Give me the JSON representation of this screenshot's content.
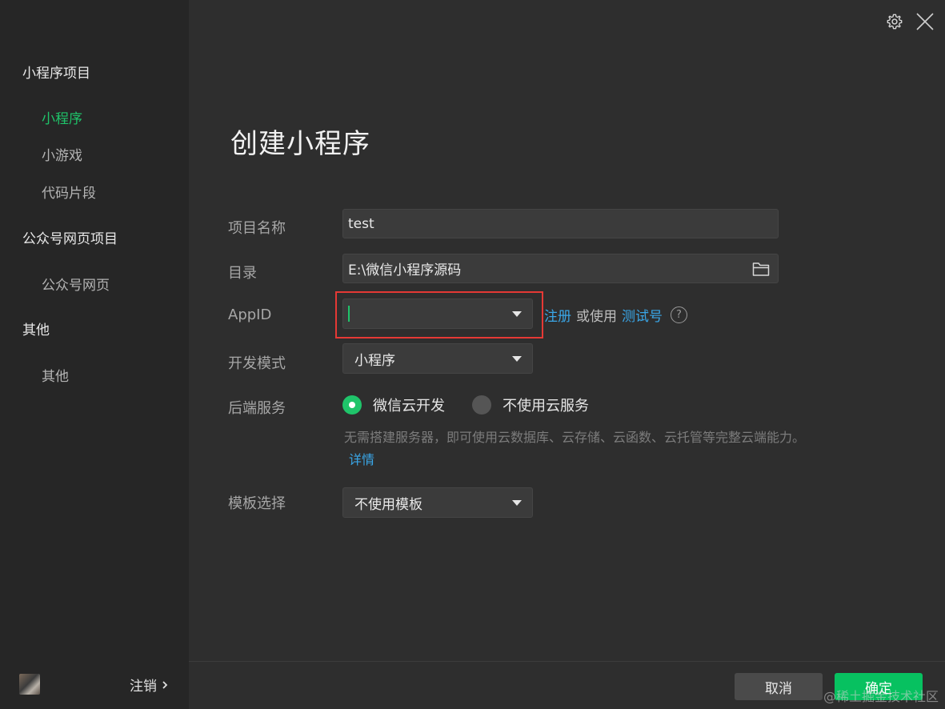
{
  "sidebar": {
    "groups": [
      {
        "title": "小程序项目",
        "items": [
          "小程序",
          "小游戏",
          "代码片段"
        ]
      },
      {
        "title": "公众号网页项目",
        "items": [
          "公众号网页"
        ]
      },
      {
        "title": "其他",
        "items": [
          "其他"
        ]
      }
    ],
    "active_item": "小程序",
    "logout_label": "注销"
  },
  "header": {
    "icons": [
      "gear-icon",
      "close-icon"
    ]
  },
  "form": {
    "title": "创建小程序",
    "project_name": {
      "label": "项目名称",
      "value": "test"
    },
    "directory": {
      "label": "目录",
      "value": "E:\\微信小程序源码"
    },
    "appid": {
      "label": "AppID",
      "value": "",
      "register_link": "注册",
      "or_use": "或使用",
      "test_link": "测试号",
      "help": "?"
    },
    "dev_mode": {
      "label": "开发模式",
      "value": "小程序"
    },
    "backend": {
      "label": "后端服务",
      "options": [
        "微信云开发",
        "不使用云服务"
      ],
      "selected": "微信云开发",
      "desc": "无需搭建服务器，即可使用云数据库、云存储、云函数、云托管等完整云端能力。",
      "details_link": "详情"
    },
    "template": {
      "label": "模板选择",
      "value": "不使用模板"
    }
  },
  "footer": {
    "cancel_label": "取消",
    "confirm_label": "确定",
    "watermark": "@稀土掘金技术社区"
  },
  "colors": {
    "accent_green": "#07c160",
    "link_blue": "#3aa7e8",
    "highlight_red": "#e53935"
  }
}
